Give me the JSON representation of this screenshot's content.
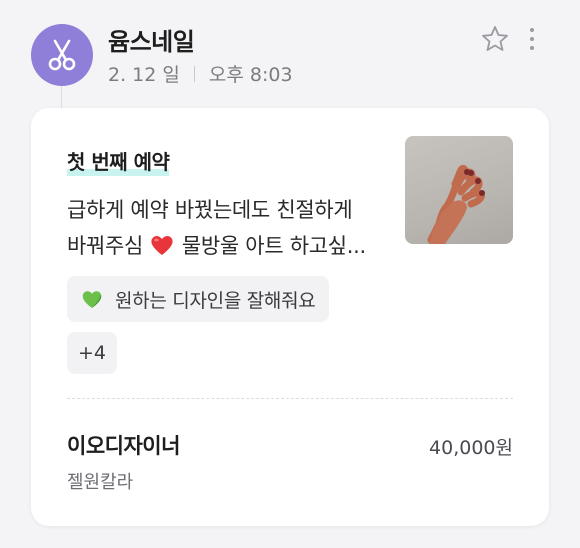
{
  "header": {
    "shop_name": "윰스네일",
    "date": "2. 12 일",
    "time": "오후 8:03",
    "avatar_icon": "scissors-icon",
    "favorite_icon": "star-outline-icon",
    "more_icon": "more-vertical-icon"
  },
  "review": {
    "badge": "첫 번째 예약",
    "text_line1": "급하게 예약 바꿨는데도 친절하게",
    "text_line2_a": "바꿔주심",
    "text_line2_b": " 물방울 아트 하고싶...",
    "emoji": "red-heart-icon",
    "photo": "hand-photo"
  },
  "tags": {
    "items": [
      {
        "icon": "green-heart-icon",
        "label": "원하는 디자인을 잘해줘요"
      }
    ],
    "more_label": "+4"
  },
  "booking": {
    "designer": "이오디자이너",
    "price": "40,000원",
    "service": "젤원칼라"
  },
  "colors": {
    "avatar_bg": "#8f7fd9",
    "badge_highlight": "#c9f3ee",
    "page_bg": "#f4f4f6"
  }
}
